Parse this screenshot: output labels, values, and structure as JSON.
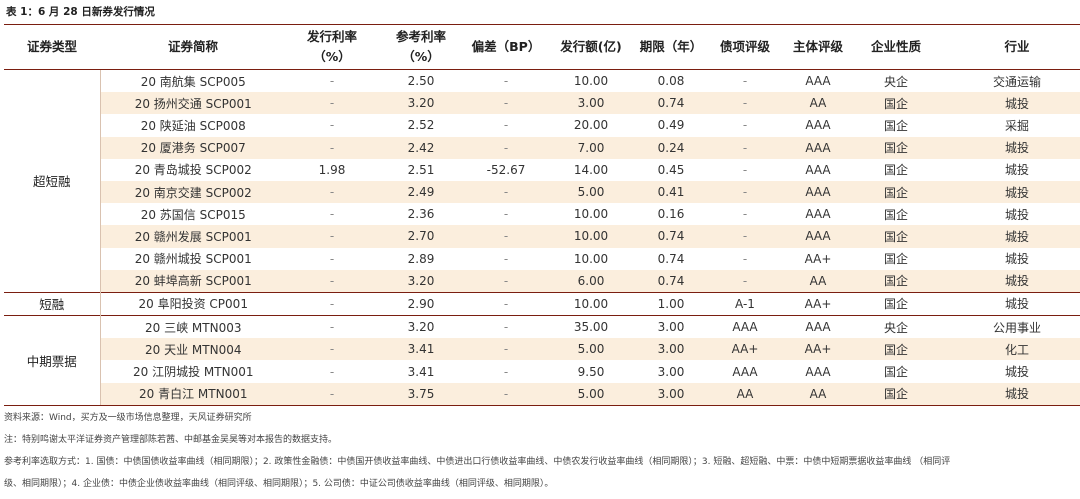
{
  "title": "表 1：6 月 28 日新券发行情况",
  "headers": [
    "证券类型",
    "证券简称",
    "发行利率\n（%）",
    "参考利率\n（%）",
    "偏差（BP）",
    "发行额(亿)",
    "期限（年）",
    "债项评级",
    "主体评级",
    "企业性质",
    "行业"
  ],
  "groups": [
    {
      "name": "超短融",
      "rows": [
        [
          "20 南航集 SCP005",
          "-",
          "2.50",
          "-",
          "10.00",
          "0.08",
          "-",
          "AAA",
          "央企",
          "交通运输"
        ],
        [
          "20 扬州交通 SCP001",
          "-",
          "3.20",
          "-",
          "3.00",
          "0.74",
          "-",
          "AA",
          "国企",
          "城投"
        ],
        [
          "20 陕延油 SCP008",
          "-",
          "2.52",
          "-",
          "20.00",
          "0.49",
          "-",
          "AAA",
          "国企",
          "采掘"
        ],
        [
          "20 厦港务 SCP007",
          "-",
          "2.42",
          "-",
          "7.00",
          "0.24",
          "-",
          "AAA",
          "国企",
          "城投"
        ],
        [
          "20 青岛城投 SCP002",
          "1.98",
          "2.51",
          "-52.67",
          "14.00",
          "0.45",
          "-",
          "AAA",
          "国企",
          "城投"
        ],
        [
          "20 南京交建 SCP002",
          "-",
          "2.49",
          "-",
          "5.00",
          "0.41",
          "-",
          "AAA",
          "国企",
          "城投"
        ],
        [
          "20 苏国信 SCP015",
          "-",
          "2.36",
          "-",
          "10.00",
          "0.16",
          "-",
          "AAA",
          "国企",
          "城投"
        ],
        [
          "20 赣州发展 SCP001",
          "-",
          "2.70",
          "-",
          "10.00",
          "0.74",
          "-",
          "AAA",
          "国企",
          "城投"
        ],
        [
          "20 赣州城投 SCP001",
          "-",
          "2.89",
          "-",
          "10.00",
          "0.74",
          "-",
          "AA+",
          "国企",
          "城投"
        ],
        [
          "20 蚌埠高新 SCP001",
          "-",
          "3.20",
          "-",
          "6.00",
          "0.74",
          "-",
          "AA",
          "国企",
          "城投"
        ]
      ]
    },
    {
      "name": "短融",
      "rows": [
        [
          "20 阜阳投资 CP001",
          "-",
          "2.90",
          "-",
          "10.00",
          "1.00",
          "A-1",
          "AA+",
          "国企",
          "城投"
        ]
      ]
    },
    {
      "name": "中期票据",
      "rows": [
        [
          "20 三峡 MTN003",
          "-",
          "3.20",
          "-",
          "35.00",
          "3.00",
          "AAA",
          "AAA",
          "央企",
          "公用事业"
        ],
        [
          "20 天业 MTN004",
          "-",
          "3.41",
          "-",
          "5.00",
          "3.00",
          "AA+",
          "AA+",
          "国企",
          "化工"
        ],
        [
          "20 江阴城投 MTN001",
          "-",
          "3.41",
          "-",
          "9.50",
          "3.00",
          "AAA",
          "AAA",
          "国企",
          "城投"
        ],
        [
          "20 青白江 MTN001",
          "-",
          "3.75",
          "-",
          "5.00",
          "3.00",
          "AA",
          "AA",
          "国企",
          "城投"
        ]
      ]
    }
  ],
  "notes": [
    "资料来源：Wind，买方及一级市场信息整理，天风证券研究所",
    "注：特别鸣谢太平洋证券资产管理部陈若茜、中邮基金吴昊等对本报告的数据支持。",
    "参考利率选取方式：1. 国债：中债国债收益率曲线（相同期限）；2. 政策性金融债：中债国开债收益率曲线、中债进出口行债收益率曲线、中债农发行收益率曲线（相同期限）；3. 短融、超短融、中票：中债中短期票据收益率曲线 （相同评",
    "级、相同期限）；4. 企业债：中债企业债收益率曲线（相同评级、相同期限）；5. 公司债：中证公司债收益率曲线（相同评级、相同期限）。"
  ]
}
